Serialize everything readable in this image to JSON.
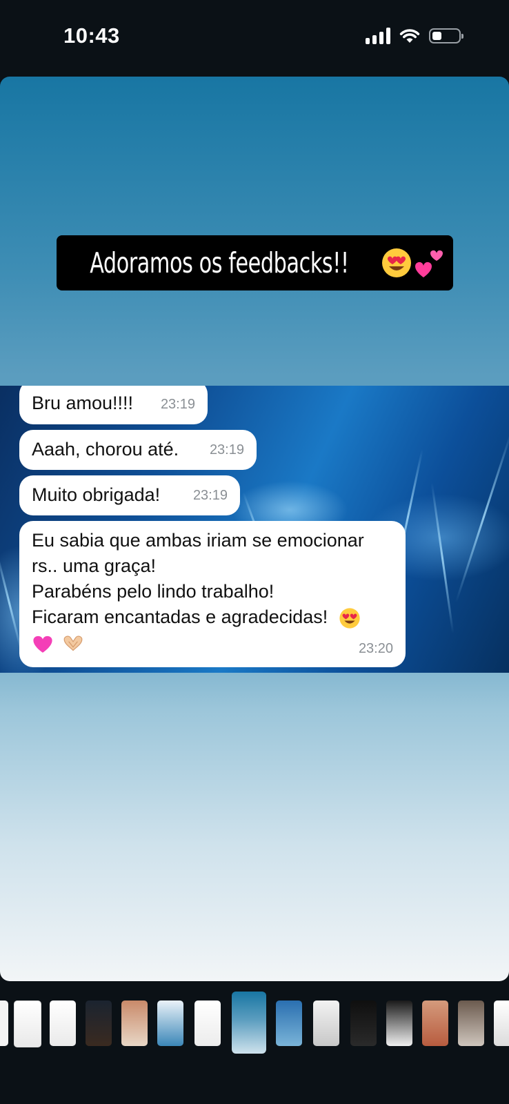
{
  "status_bar": {
    "time": "10:43"
  },
  "story": {
    "caption": "Adoramos os feedbacks!!",
    "messages": [
      {
        "text": "Bru amou!!!!",
        "time": "23:19"
      },
      {
        "text": "Aaah, chorou até.",
        "time": "23:19"
      },
      {
        "text": "Muito obrigada!",
        "time": "23:19"
      },
      {
        "lines": [
          "Eu sabia que ambas iriam se emocionar",
          "rs.. uma graça!",
          "Parabéns pelo lindo trabalho!",
          "Ficaram encantadas e agradecidas!"
        ],
        "time": "23:20"
      }
    ]
  },
  "colors": {
    "story_top": "#1876a3",
    "story_bottom": "#f2f5f7",
    "caption_bg": "#000000"
  },
  "icons": [
    "signal-icon",
    "wifi-icon",
    "battery-icon",
    "heart-eyes-emoji",
    "two-hearts-emoji",
    "pink-heart-emoji",
    "heart-hands-emoji"
  ]
}
